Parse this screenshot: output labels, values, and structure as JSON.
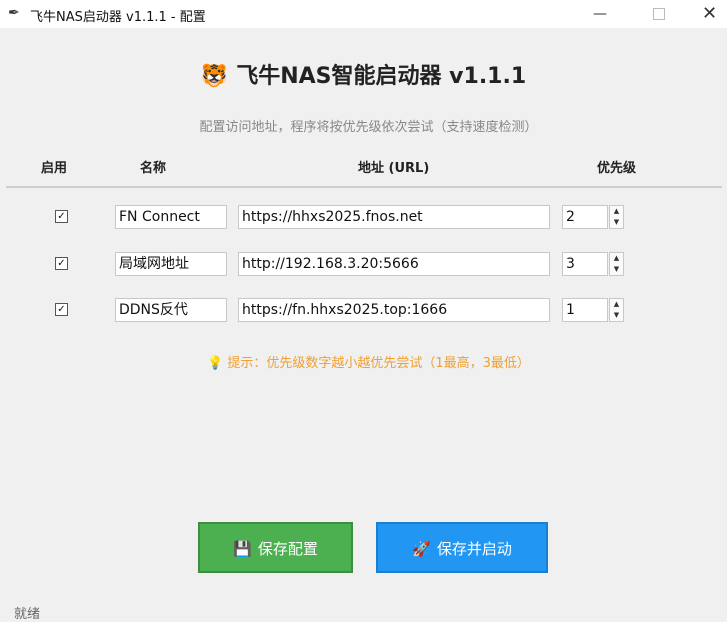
{
  "window": {
    "title": "飞牛NAS启动器 v1.1.1 - 配置",
    "app_icon": "feather-icon",
    "minimize_glyph": "—",
    "close_glyph": "✕"
  },
  "header": {
    "icon_glyph": "🐯",
    "title": "飞牛NAS智能启动器 v1.1.1",
    "subtitle": "配置访问地址，程序将按优先级依次尝试（支持速度检测）"
  },
  "table": {
    "columns": {
      "enabled": "启用",
      "name": "名称",
      "url": "地址 (URL)",
      "priority": "优先级"
    },
    "rows": [
      {
        "enabled": true,
        "check_glyph": "✓",
        "name": "FN Connect",
        "url": "https://hhxs2025.fnos.net",
        "priority": "2"
      },
      {
        "enabled": true,
        "check_glyph": "✓",
        "name": "局域网地址",
        "url": "http://192.168.3.20:5666",
        "priority": "3"
      },
      {
        "enabled": true,
        "check_glyph": "✓",
        "name": "DDNS反代",
        "url": "https://fn.hhxs2025.top:1666",
        "priority": "1"
      }
    ]
  },
  "tip": {
    "icon_glyph": "💡",
    "text": "提示：优先级数字越小越优先尝试（1最高，3最低）"
  },
  "buttons": {
    "save": {
      "icon_glyph": "💾",
      "label": "保存配置"
    },
    "start": {
      "icon_glyph": "🚀",
      "label": "保存并启动"
    }
  },
  "status": {
    "text": "就绪"
  },
  "colors": {
    "save_button": "#4caf50",
    "start_button": "#2196f3",
    "tip_text": "#f0a030",
    "background": "#f0f0f0"
  }
}
